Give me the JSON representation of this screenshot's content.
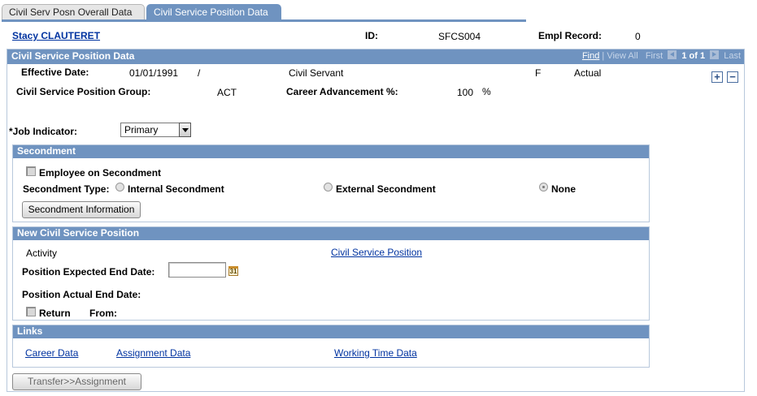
{
  "tabs": [
    {
      "label": "Civil Serv Posn Overall Data",
      "active": false
    },
    {
      "label": "Civil Service Position Data",
      "active": true
    }
  ],
  "header": {
    "employee_name": "Stacy CLAUTERET",
    "id_label": "ID:",
    "id_value": "SFCS004",
    "empl_record_label": "Empl Record:",
    "empl_record_value": "0"
  },
  "section": {
    "title": "Civil Service Position Data",
    "nav": {
      "find": "Find",
      "view_all": "View All",
      "first": "First",
      "count": "1 of 1",
      "last": "Last"
    }
  },
  "fields": {
    "effective_date_label": "Effective Date:",
    "effective_date_value": "01/01/1991",
    "separator": "/",
    "status_text": "Civil Servant",
    "status_code": "F",
    "status_kind": "Actual",
    "position_group_label": "Civil Service Position Group:",
    "position_group_value": "ACT",
    "career_adv_label": "Career Advancement %:",
    "career_adv_value": "100",
    "percent_sign": "%",
    "job_indicator_label": "*Job Indicator:",
    "job_indicator_value": "Primary"
  },
  "secondment": {
    "title": "Secondment",
    "employee_on_secondment": "Employee on Secondment",
    "type_label": "Secondment Type:",
    "internal": "Internal Secondment",
    "external": "External Secondment",
    "none": "None",
    "selected": "None",
    "button": "Secondment Information"
  },
  "new_position": {
    "title": "New Civil Service Position",
    "activity_label": "Activity",
    "civil_service_position_link": "Civil Service Position",
    "expected_end_label": "Position Expected End Date:",
    "expected_end_value": "",
    "actual_end_label": "Position Actual End Date:",
    "return_label": "Return",
    "from_label": "From:",
    "calendar_glyph": "31"
  },
  "links": {
    "title": "Links",
    "career_data": "Career Data",
    "assignment_data": "Assignment Data",
    "working_time_data": "Working Time Data"
  },
  "footer": {
    "transfer_button": "Transfer>>Assignment"
  },
  "colors": {
    "header_blue": "#6f93c0",
    "link_blue": "#0033a0"
  }
}
